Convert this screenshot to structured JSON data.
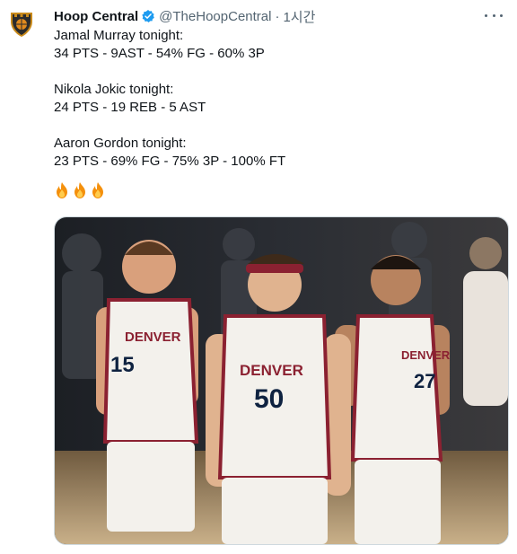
{
  "tweet": {
    "display_name": "Hoop Central",
    "verified": true,
    "handle": "@TheHoopCentral",
    "separator": "·",
    "time": "1시간",
    "lines": [
      "Jamal Murray tonight:",
      "34 PTS - 9AST - 54% FG - 60% 3P",
      "",
      "Nikola Jokic tonight:",
      "24 PTS - 19 REB - 5 AST",
      "",
      "Aaron Gordon tonight:",
      "23 PTS - 69% FG - 75% 3P - 100% FT"
    ],
    "emoji": [
      "fire-icon",
      "fire-icon",
      "fire-icon"
    ],
    "media": {
      "jerseys": [
        {
          "team": "DENVER",
          "number": "15"
        },
        {
          "team": "DENVER",
          "number": "50"
        },
        {
          "team": "DENVER",
          "number": "27"
        }
      ]
    }
  },
  "colors": {
    "text": "#0f1419",
    "muted": "#536471",
    "verified": "#1d9bf0",
    "nuggets_navy": "#0e2240",
    "nuggets_gold": "#fec524",
    "nuggets_red": "#8b2131"
  }
}
